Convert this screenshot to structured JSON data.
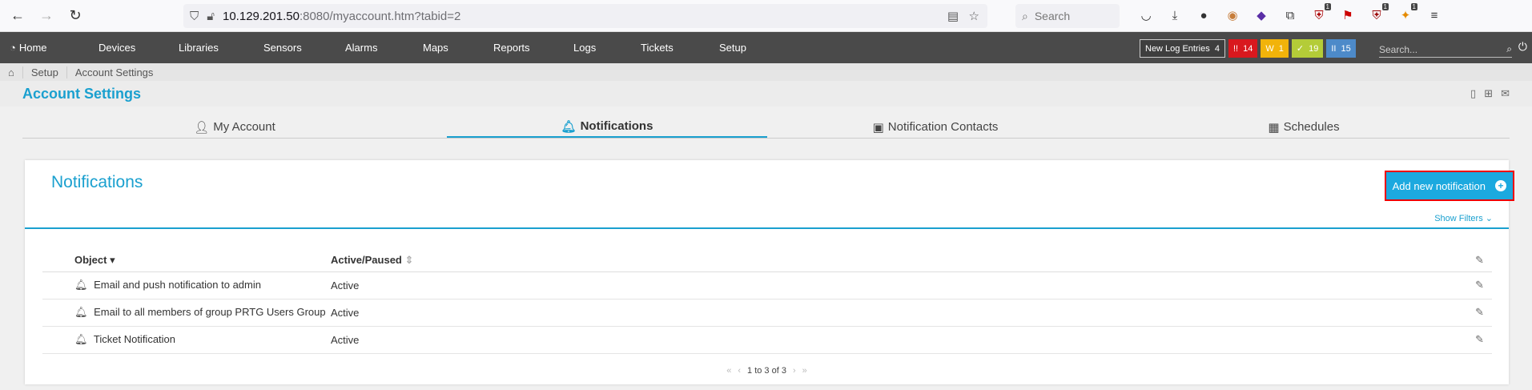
{
  "browser": {
    "url_host": "10.129.201.50",
    "url_path": ":8080/myaccount.htm?tabid=2",
    "search_placeholder": "Search",
    "ext_badges": [
      "1",
      "1",
      "1"
    ]
  },
  "nav": {
    "home": "Home",
    "items": [
      "Devices",
      "Libraries",
      "Sensors",
      "Alarms",
      "Maps",
      "Reports",
      "Logs",
      "Tickets",
      "Setup"
    ],
    "log_entries_label": "New Log Entries",
    "log_entries_count": "4",
    "status": [
      {
        "label": "!!",
        "count": "14",
        "color": "#d9181e"
      },
      {
        "label": "W",
        "count": "1",
        "color": "#f2b30a"
      },
      {
        "label": "✓",
        "count": "19",
        "color": "#b4cc38"
      },
      {
        "label": "II",
        "count": "15",
        "color": "#4d8ac9"
      }
    ],
    "search_placeholder": "Search..."
  },
  "breadcrumb": [
    "Setup",
    "Account Settings"
  ],
  "page_title": "Account Settings",
  "tabs": [
    {
      "label": "My Account",
      "icon": "user-icon"
    },
    {
      "label": "Notifications",
      "icon": "bell-icon",
      "active": true
    },
    {
      "label": "Notification Contacts",
      "icon": "contact-icon"
    },
    {
      "label": "Schedules",
      "icon": "calendar-icon"
    }
  ],
  "panel": {
    "title": "Notifications",
    "add_button": "Add new notification",
    "show_filters": "Show Filters"
  },
  "table": {
    "columns": [
      "Object",
      "Active/Paused"
    ],
    "rows": [
      {
        "object": "Email and push notification to admin",
        "status": "Active"
      },
      {
        "object": "Email to all members of group PRTG Users Group",
        "status": "Active"
      },
      {
        "object": "Ticket Notification",
        "status": "Active"
      }
    ]
  },
  "pager": {
    "text": "1 to 3 of 3"
  }
}
